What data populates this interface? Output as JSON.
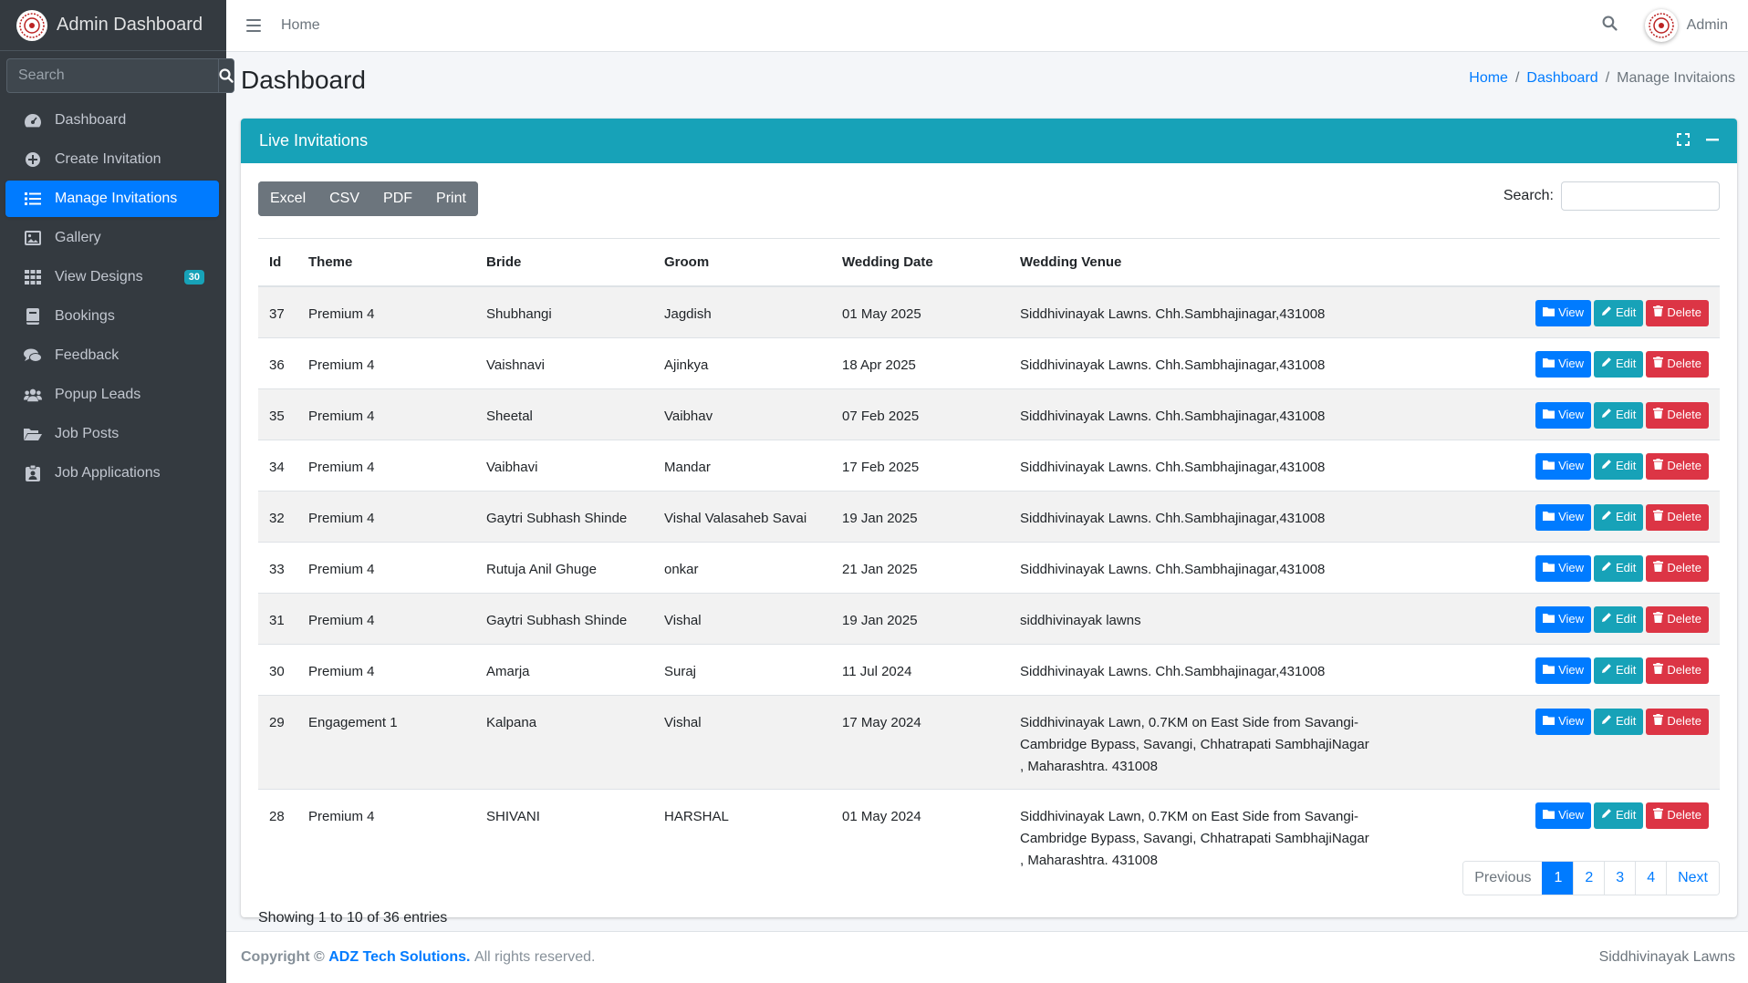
{
  "brand": {
    "title": "Admin Dashboard",
    "logo_icon": "mandala-logo-icon"
  },
  "sidebar": {
    "search_placeholder": "Search",
    "items": [
      {
        "label": "Dashboard",
        "icon": "tachometer-icon"
      },
      {
        "label": "Create Invitation",
        "icon": "plus-circle-icon"
      },
      {
        "label": "Manage Invitations",
        "icon": "list-icon",
        "active": true
      },
      {
        "label": "Gallery",
        "icon": "image-icon"
      },
      {
        "label": "View Designs",
        "icon": "grid-icon",
        "badge": "30"
      },
      {
        "label": "Bookings",
        "icon": "book-icon"
      },
      {
        "label": "Feedback",
        "icon": "comments-icon"
      },
      {
        "label": "Popup Leads",
        "icon": "users-icon"
      },
      {
        "label": "Job Posts",
        "icon": "folder-open-icon"
      },
      {
        "label": "Job Applications",
        "icon": "id-badge-icon"
      }
    ]
  },
  "topbar": {
    "home_label": "Home",
    "user_name": "Admin"
  },
  "header": {
    "title": "Dashboard",
    "breadcrumb": [
      "Home",
      "Dashboard",
      "Manage Invitaions"
    ]
  },
  "card": {
    "title": "Live Invitations",
    "export_buttons": [
      "Excel",
      "CSV",
      "PDF",
      "Print"
    ],
    "search_label": "Search:",
    "search_value": ""
  },
  "table": {
    "columns": [
      "Id",
      "Theme",
      "Bride",
      "Groom",
      "Wedding Date",
      "Wedding Venue",
      ""
    ],
    "action_labels": {
      "view": "View",
      "edit": "Edit",
      "delete": "Delete"
    },
    "rows": [
      [
        "37",
        "Premium 4",
        "Shubhangi",
        "Jagdish",
        "01 May 2025",
        "Siddhivinayak Lawns. Chh.Sambhajinagar,431008"
      ],
      [
        "36",
        "Premium 4",
        "Vaishnavi",
        "Ajinkya",
        "18 Apr 2025",
        "Siddhivinayak Lawns. Chh.Sambhajinagar,431008"
      ],
      [
        "35",
        "Premium 4",
        "Sheetal",
        "Vaibhav",
        "07 Feb 2025",
        "Siddhivinayak Lawns. Chh.Sambhajinagar,431008"
      ],
      [
        "34",
        "Premium 4",
        "Vaibhavi",
        "Mandar",
        "17 Feb 2025",
        "Siddhivinayak Lawns. Chh.Sambhajinagar,431008"
      ],
      [
        "32",
        "Premium 4",
        "Gaytri Subhash Shinde",
        "Vishal Valasaheb Savai",
        "19 Jan 2025",
        "Siddhivinayak Lawns. Chh.Sambhajinagar,431008"
      ],
      [
        "33",
        "Premium 4",
        "Rutuja Anil Ghuge",
        "onkar",
        "21 Jan 2025",
        "Siddhivinayak Lawns. Chh.Sambhajinagar,431008"
      ],
      [
        "31",
        "Premium 4",
        "Gaytri Subhash Shinde",
        "Vishal",
        "19 Jan 2025",
        "siddhivinayak lawns"
      ],
      [
        "30",
        "Premium 4",
        "Amarja",
        "Suraj",
        "11 Jul 2024",
        "Siddhivinayak Lawns. Chh.Sambhajinagar,431008"
      ],
      [
        "29",
        "Engagement 1",
        "Kalpana",
        "Vishal",
        "17 May 2024",
        "Siddhivinayak Lawn, 0.7KM on East Side from Savangi-Cambridge Bypass, Savangi, Chhatrapati SambhajiNagar , Maharashtra. 431008"
      ],
      [
        "28",
        "Premium 4",
        "SHIVANI",
        "HARSHAL",
        "01 May 2024",
        "Siddhivinayak Lawn, 0.7KM on East Side from Savangi-Cambridge Bypass, Savangi, Chhatrapati SambhajiNagar , Maharashtra. 431008"
      ]
    ]
  },
  "pagination": {
    "info": "Showing 1 to 10 of 36 entries",
    "previous": "Previous",
    "pages": [
      "1",
      "2",
      "3",
      "4"
    ],
    "active_page": "1",
    "next": "Next"
  },
  "footer": {
    "copyright": "Copyright ©",
    "company": "ADZ Tech Solutions.",
    "rights": "All rights reserved.",
    "right_text": "Siddhivinayak Lawns"
  },
  "colors": {
    "sidebar_bg": "#343a40",
    "primary": "#007bff",
    "info": "#17a2b8",
    "danger": "#dc3545",
    "secondary": "#6c757d"
  }
}
